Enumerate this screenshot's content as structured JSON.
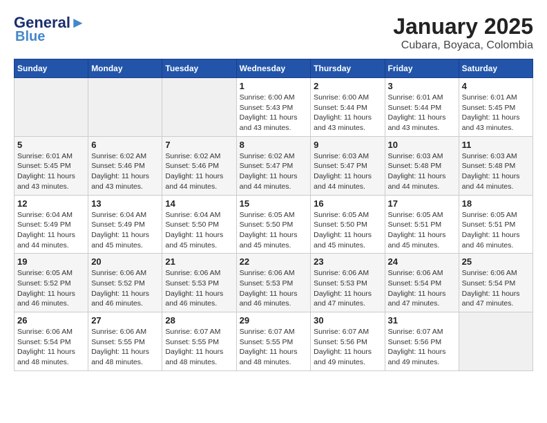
{
  "header": {
    "logo_line1": "General",
    "logo_line2": "Blue",
    "title": "January 2025",
    "subtitle": "Cubara, Boyaca, Colombia"
  },
  "calendar": {
    "days_of_week": [
      "Sunday",
      "Monday",
      "Tuesday",
      "Wednesday",
      "Thursday",
      "Friday",
      "Saturday"
    ],
    "weeks": [
      [
        {
          "day": "",
          "info": ""
        },
        {
          "day": "",
          "info": ""
        },
        {
          "day": "",
          "info": ""
        },
        {
          "day": "1",
          "info": "Sunrise: 6:00 AM\nSunset: 5:43 PM\nDaylight: 11 hours and 43 minutes."
        },
        {
          "day": "2",
          "info": "Sunrise: 6:00 AM\nSunset: 5:44 PM\nDaylight: 11 hours and 43 minutes."
        },
        {
          "day": "3",
          "info": "Sunrise: 6:01 AM\nSunset: 5:44 PM\nDaylight: 11 hours and 43 minutes."
        },
        {
          "day": "4",
          "info": "Sunrise: 6:01 AM\nSunset: 5:45 PM\nDaylight: 11 hours and 43 minutes."
        }
      ],
      [
        {
          "day": "5",
          "info": "Sunrise: 6:01 AM\nSunset: 5:45 PM\nDaylight: 11 hours and 43 minutes."
        },
        {
          "day": "6",
          "info": "Sunrise: 6:02 AM\nSunset: 5:46 PM\nDaylight: 11 hours and 43 minutes."
        },
        {
          "day": "7",
          "info": "Sunrise: 6:02 AM\nSunset: 5:46 PM\nDaylight: 11 hours and 44 minutes."
        },
        {
          "day": "8",
          "info": "Sunrise: 6:02 AM\nSunset: 5:47 PM\nDaylight: 11 hours and 44 minutes."
        },
        {
          "day": "9",
          "info": "Sunrise: 6:03 AM\nSunset: 5:47 PM\nDaylight: 11 hours and 44 minutes."
        },
        {
          "day": "10",
          "info": "Sunrise: 6:03 AM\nSunset: 5:48 PM\nDaylight: 11 hours and 44 minutes."
        },
        {
          "day": "11",
          "info": "Sunrise: 6:03 AM\nSunset: 5:48 PM\nDaylight: 11 hours and 44 minutes."
        }
      ],
      [
        {
          "day": "12",
          "info": "Sunrise: 6:04 AM\nSunset: 5:49 PM\nDaylight: 11 hours and 44 minutes."
        },
        {
          "day": "13",
          "info": "Sunrise: 6:04 AM\nSunset: 5:49 PM\nDaylight: 11 hours and 45 minutes."
        },
        {
          "day": "14",
          "info": "Sunrise: 6:04 AM\nSunset: 5:50 PM\nDaylight: 11 hours and 45 minutes."
        },
        {
          "day": "15",
          "info": "Sunrise: 6:05 AM\nSunset: 5:50 PM\nDaylight: 11 hours and 45 minutes."
        },
        {
          "day": "16",
          "info": "Sunrise: 6:05 AM\nSunset: 5:50 PM\nDaylight: 11 hours and 45 minutes."
        },
        {
          "day": "17",
          "info": "Sunrise: 6:05 AM\nSunset: 5:51 PM\nDaylight: 11 hours and 45 minutes."
        },
        {
          "day": "18",
          "info": "Sunrise: 6:05 AM\nSunset: 5:51 PM\nDaylight: 11 hours and 46 minutes."
        }
      ],
      [
        {
          "day": "19",
          "info": "Sunrise: 6:05 AM\nSunset: 5:52 PM\nDaylight: 11 hours and 46 minutes."
        },
        {
          "day": "20",
          "info": "Sunrise: 6:06 AM\nSunset: 5:52 PM\nDaylight: 11 hours and 46 minutes."
        },
        {
          "day": "21",
          "info": "Sunrise: 6:06 AM\nSunset: 5:53 PM\nDaylight: 11 hours and 46 minutes."
        },
        {
          "day": "22",
          "info": "Sunrise: 6:06 AM\nSunset: 5:53 PM\nDaylight: 11 hours and 46 minutes."
        },
        {
          "day": "23",
          "info": "Sunrise: 6:06 AM\nSunset: 5:53 PM\nDaylight: 11 hours and 47 minutes."
        },
        {
          "day": "24",
          "info": "Sunrise: 6:06 AM\nSunset: 5:54 PM\nDaylight: 11 hours and 47 minutes."
        },
        {
          "day": "25",
          "info": "Sunrise: 6:06 AM\nSunset: 5:54 PM\nDaylight: 11 hours and 47 minutes."
        }
      ],
      [
        {
          "day": "26",
          "info": "Sunrise: 6:06 AM\nSunset: 5:54 PM\nDaylight: 11 hours and 48 minutes."
        },
        {
          "day": "27",
          "info": "Sunrise: 6:06 AM\nSunset: 5:55 PM\nDaylight: 11 hours and 48 minutes."
        },
        {
          "day": "28",
          "info": "Sunrise: 6:07 AM\nSunset: 5:55 PM\nDaylight: 11 hours and 48 minutes."
        },
        {
          "day": "29",
          "info": "Sunrise: 6:07 AM\nSunset: 5:55 PM\nDaylight: 11 hours and 48 minutes."
        },
        {
          "day": "30",
          "info": "Sunrise: 6:07 AM\nSunset: 5:56 PM\nDaylight: 11 hours and 49 minutes."
        },
        {
          "day": "31",
          "info": "Sunrise: 6:07 AM\nSunset: 5:56 PM\nDaylight: 11 hours and 49 minutes."
        },
        {
          "day": "",
          "info": ""
        }
      ]
    ]
  }
}
